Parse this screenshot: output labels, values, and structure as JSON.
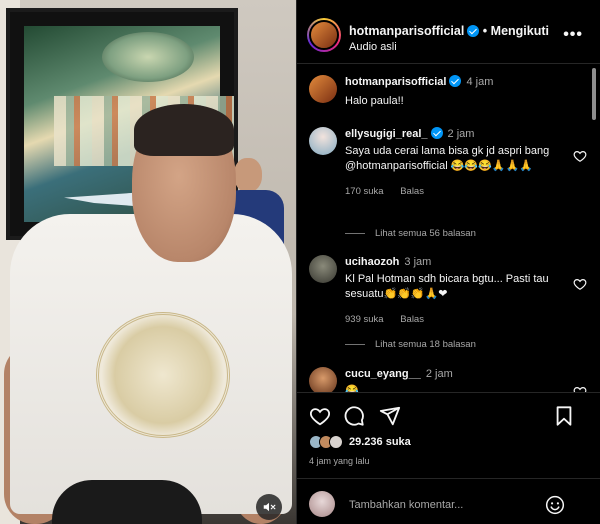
{
  "post": {
    "username": "hotmanparisofficial",
    "separator": "•",
    "follow_label": "Mengikuti",
    "audio": "Audio asli",
    "more_label": "•••"
  },
  "caption": {
    "username": "hotmanparisofficial",
    "time": "4 jam",
    "text": "Halo paula!!"
  },
  "comments": [
    {
      "username": "ellysugigi_real_",
      "time": "2 jam",
      "text": "Saya uda cerai lama bisa gk jd aspri bang @hotmanparisofficial 😂😂😂🙏🙏🙏",
      "likes": "170 suka",
      "reply_label": "Balas",
      "view_replies": "Lihat semua 56 balasan"
    },
    {
      "username": "ucihaozoh",
      "time": "3 jam",
      "text": "Kl Pal Hotman sdh bicara bgtu... Pasti tau sesuatu👏👏👏🙏❤",
      "likes": "939 suka",
      "reply_label": "Balas",
      "view_replies": "Lihat semua 18 balasan"
    },
    {
      "username": "cucu_eyang__",
      "time": "2 jam",
      "text": "😂"
    }
  ],
  "footer": {
    "likes_count": "29.236 suka",
    "posted_ago": "4 jam yang lalu",
    "comment_placeholder": "Tambahkan komentar..."
  },
  "colors": {
    "background": "#000000",
    "text": "#f5f5f5",
    "muted": "#a8a8a8",
    "verified": "#0095f6",
    "divider": "#262626"
  },
  "icons": [
    "verified-badge-icon",
    "more-options-icon",
    "heart-icon",
    "comment-icon",
    "share-icon",
    "bookmark-icon",
    "emoji-icon",
    "mute-icon"
  ]
}
